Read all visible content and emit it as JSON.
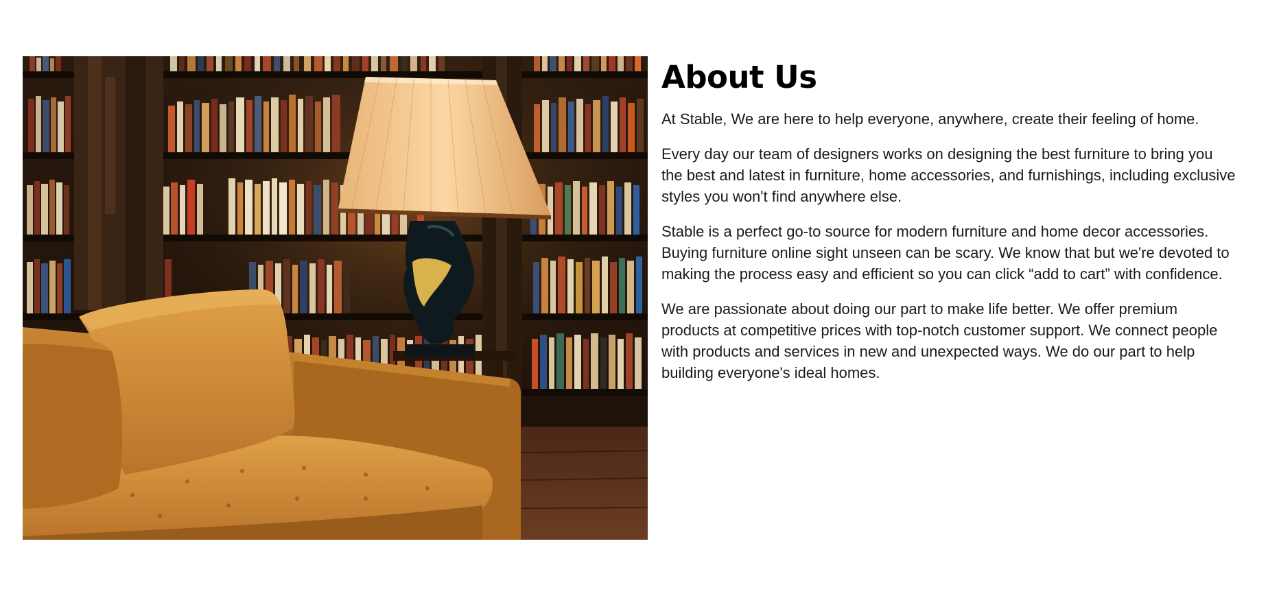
{
  "about": {
    "title": "About Us",
    "paragraphs": [
      "At Stable, We are here to help everyone, anywhere, create their feeling of home.",
      "Every day our team of designers works on designing the best furniture to bring you the best and latest in furniture, home accessories, and furnishings, including exclusive styles you won't find anywhere else.",
      "Stable is a perfect go-to source for modern furniture and home decor accessories. Buying furniture online sight unseen can be scary. We know that but we're devoted to making the process easy and efficient so you can click “add to cart” with confidence.",
      "We are passionate about doing our part to make life better. We offer premium products at competitive prices with top-notch customer support. We connect people with products and services in new and unexpected ways. We do our part to help building everyone's ideal homes."
    ]
  },
  "image": {
    "subject": "living-room-photo",
    "colors": {
      "shelf_dark": "#1c120b",
      "wood": "#3d2616",
      "sofa": "#b9742a",
      "sofa_light": "#d8973f",
      "lampshade": "#f2c489",
      "floor": "#5a3320"
    }
  }
}
